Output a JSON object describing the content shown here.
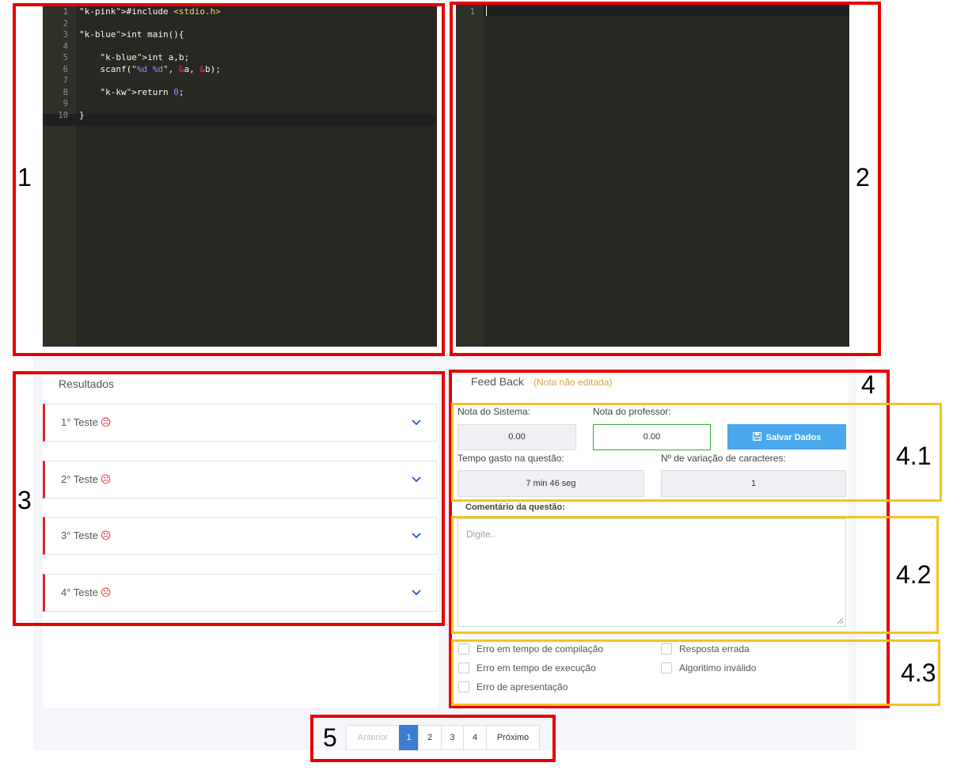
{
  "annotations": {
    "box1": "1",
    "box2": "2",
    "box3": "3",
    "box4": "4",
    "box41": "4.1",
    "box42": "4.2",
    "box43": "4.3",
    "box5": "5"
  },
  "code_editor": {
    "line_numbers": [
      "1",
      "2",
      "3",
      "4",
      "5",
      "6",
      "7",
      "8",
      "9",
      "10"
    ],
    "lines": [
      "#include <stdio.h>",
      "",
      "int main(){",
      "",
      "    int a,b;",
      "    scanf(\"%d %d\", &a, &b);",
      "",
      "    return 0;",
      "",
      "}"
    ],
    "active_line": 10
  },
  "output_editor": {
    "line_numbers": [
      "1"
    ]
  },
  "results": {
    "title": "Resultados",
    "tests": [
      {
        "label": "1° Teste",
        "status_icon": "sad-face-icon"
      },
      {
        "label": "2° Teste",
        "status_icon": "sad-face-icon"
      },
      {
        "label": "3° Teste",
        "status_icon": "sad-face-icon"
      },
      {
        "label": "4° Teste",
        "status_icon": "sad-face-icon"
      }
    ],
    "sad_glyph": "☹"
  },
  "feedback": {
    "title": "Feed Back",
    "note": "(Nota não editada)",
    "system_grade_label": "Nota do Sistema:",
    "system_grade_value": "0.00",
    "teacher_grade_label": "Nota do professor:",
    "teacher_grade_value": "0.00",
    "save_label": "Salvar Dados",
    "time_label": "Tempo gasto na questão:",
    "time_value": "7 min 46 seg",
    "variation_label": "Nº de variação de caracteres:",
    "variation_value": "1",
    "comment_label": "Comentário da questão:",
    "comment_placeholder": "Digite..",
    "checkboxes_left": [
      "Erro em tempo de compilação",
      "Erro em tempo de execução",
      "Erro de apresentação"
    ],
    "checkboxes_right": [
      "Resposta errada",
      "Algoritimo inválido"
    ]
  },
  "pagination": {
    "prev": "Anterior",
    "pages": [
      "1",
      "2",
      "3",
      "4"
    ],
    "active_page": "1",
    "next": "Próximo"
  },
  "colors": {
    "editor_bg": "#272822",
    "highlight_red": "#e60000",
    "highlight_yellow": "#f5c220",
    "failed_test": "#d9252b",
    "save_button": "#4aa8ec",
    "active_page": "#3a7dd2"
  }
}
